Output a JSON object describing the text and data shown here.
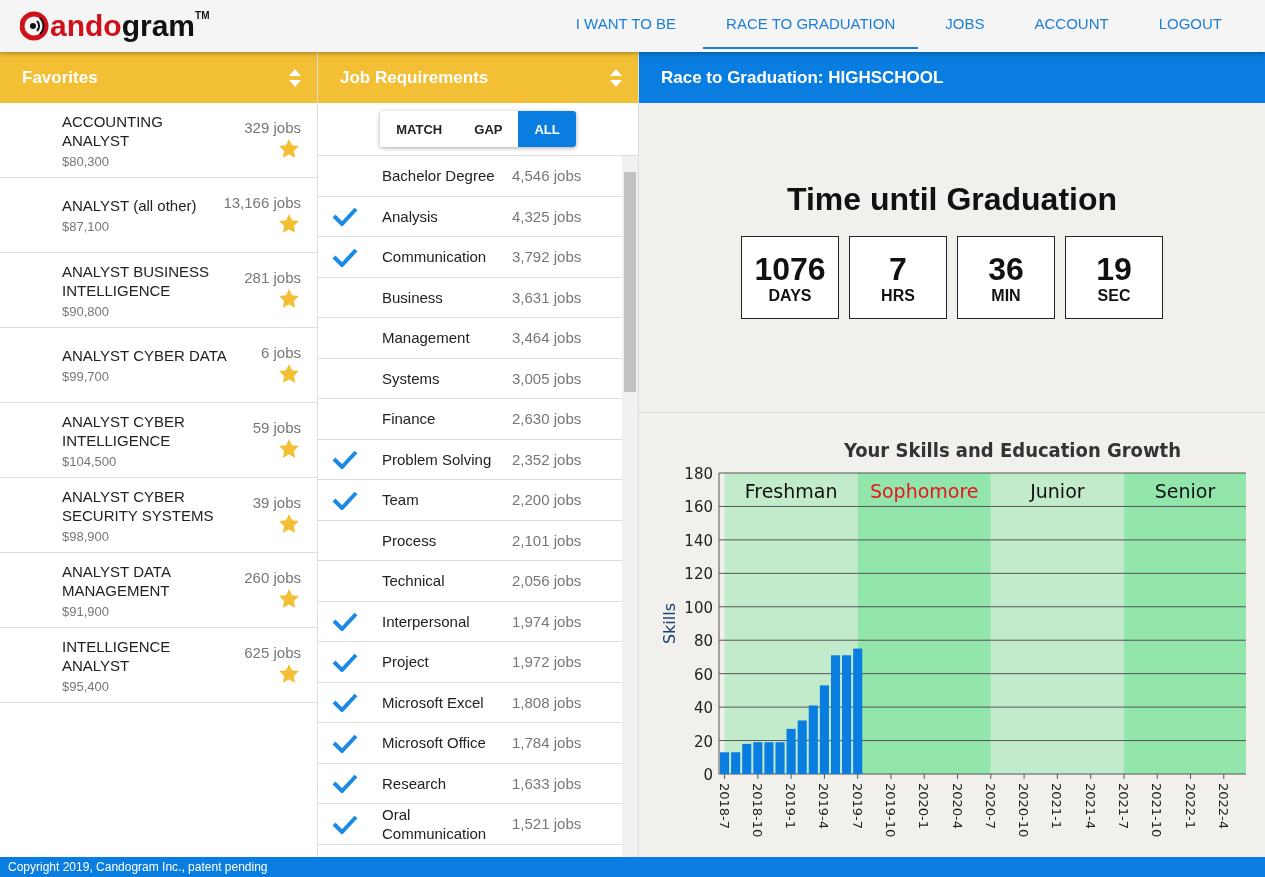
{
  "header": {
    "logo": {
      "red": "ando",
      "black": "gram",
      "tm": "TM"
    },
    "nav": [
      {
        "label": "I WANT TO BE",
        "selected": false
      },
      {
        "label": "RACE TO GRADUATION",
        "selected": true
      },
      {
        "label": "JOBS",
        "selected": false
      },
      {
        "label": "ACCOUNT",
        "selected": false
      },
      {
        "label": "LOGOUT",
        "selected": false
      }
    ]
  },
  "favorites": {
    "title": "Favorites",
    "items": [
      {
        "name": "ACCOUNTING ANALYST",
        "salary": "$80,300",
        "count": "329 jobs",
        "starred": true
      },
      {
        "name": "ANALYST (all other)",
        "salary": "$87,100",
        "count": "13,166 jobs",
        "starred": true
      },
      {
        "name": "ANALYST BUSINESS INTELLIGENCE",
        "salary": "$90,800",
        "count": "281 jobs",
        "starred": true
      },
      {
        "name": "ANALYST CYBER DATA",
        "salary": "$99,700",
        "count": "6 jobs",
        "starred": true
      },
      {
        "name": "ANALYST CYBER INTELLIGENCE",
        "salary": "$104,500",
        "count": "59 jobs",
        "starred": true
      },
      {
        "name": "ANALYST CYBER SECURITY SYSTEMS",
        "salary": "$98,900",
        "count": "39 jobs",
        "starred": true
      },
      {
        "name": "ANALYST DATA MANAGEMENT",
        "salary": "$91,900",
        "count": "260 jobs",
        "starred": true
      },
      {
        "name": "INTELLIGENCE ANALYST",
        "salary": "$95,400",
        "count": "625 jobs",
        "starred": true
      }
    ]
  },
  "requirements": {
    "title": "Job Requirements",
    "filters": [
      {
        "label": "MATCH",
        "selected": false
      },
      {
        "label": "GAP",
        "selected": false
      },
      {
        "label": "ALL",
        "selected": true
      }
    ],
    "items": [
      {
        "name": "Bachelor Degree",
        "count": "4,546 jobs",
        "checked": false
      },
      {
        "name": "Analysis",
        "count": "4,325 jobs",
        "checked": true
      },
      {
        "name": "Communication",
        "count": "3,792 jobs",
        "checked": true
      },
      {
        "name": "Business",
        "count": "3,631 jobs",
        "checked": false
      },
      {
        "name": "Management",
        "count": "3,464 jobs",
        "checked": false
      },
      {
        "name": "Systems",
        "count": "3,005 jobs",
        "checked": false
      },
      {
        "name": "Finance",
        "count": "2,630 jobs",
        "checked": false
      },
      {
        "name": "Problem Solving",
        "count": "2,352 jobs",
        "checked": true
      },
      {
        "name": "Team",
        "count": "2,200 jobs",
        "checked": true
      },
      {
        "name": "Process",
        "count": "2,101 jobs",
        "checked": false
      },
      {
        "name": "Technical",
        "count": "2,056 jobs",
        "checked": false
      },
      {
        "name": "Interpersonal",
        "count": "1,974 jobs",
        "checked": true
      },
      {
        "name": "Project",
        "count": "1,972 jobs",
        "checked": true
      },
      {
        "name": "Microsoft Excel",
        "count": "1,808 jobs",
        "checked": true
      },
      {
        "name": "Microsoft Office",
        "count": "1,784 jobs",
        "checked": true
      },
      {
        "name": "Research",
        "count": "1,633 jobs",
        "checked": true
      },
      {
        "name": "Oral Communication",
        "count": "1,521 jobs",
        "checked": true
      }
    ]
  },
  "race": {
    "title": "Race to Graduation: HIGHSCHOOL",
    "countdown_title": "Time until Graduation",
    "countdown": [
      {
        "value": "1076",
        "unit": "DAYS"
      },
      {
        "value": "7",
        "unit": "HRS"
      },
      {
        "value": "36",
        "unit": "MIN"
      },
      {
        "value": "19",
        "unit": "SEC"
      }
    ],
    "chart_data": {
      "type": "bar",
      "title": "Your Skills and Education Growth",
      "ylabel": "Skills",
      "categories": [
        "2018-7",
        null,
        null,
        "2018-10",
        null,
        null,
        "2019-1",
        null,
        null,
        "2019-4",
        null,
        null,
        "2019-7",
        null,
        null,
        "2019-10",
        null,
        null,
        "2020-1",
        null,
        null,
        "2020-4",
        null,
        null,
        "2020-7",
        null,
        null,
        "2020-10",
        null,
        null,
        "2021-1",
        null,
        null,
        "2021-4",
        null,
        null,
        "2021-7",
        null,
        null,
        "2021-10",
        null,
        null,
        "2022-1",
        null,
        null,
        "2022-4",
        null
      ],
      "series": [
        {
          "color": "#0a7de0",
          "values": [
            13,
            13,
            18,
            19,
            19,
            19,
            27,
            32,
            41,
            53,
            71,
            71,
            75,
            null,
            null,
            null,
            null,
            null,
            null,
            null,
            null,
            null,
            null,
            null,
            null,
            null,
            null,
            null,
            null,
            null,
            null,
            null,
            null,
            null,
            null,
            null,
            null,
            null,
            null,
            null,
            null,
            null,
            null,
            null,
            null,
            null,
            null
          ]
        }
      ],
      "ylim": [
        0,
        180
      ],
      "grid": true,
      "yticks": [
        0,
        20,
        40,
        60,
        80,
        100,
        120,
        140,
        160,
        180
      ]
    },
    "phases": [
      {
        "label": "Freshman",
        "color": "#c2ebcb",
        "current": false
      },
      {
        "label": "Sophomore",
        "color": "#93e6ab",
        "current": true
      },
      {
        "label": "Junior",
        "color": "#c2ebcb",
        "current": false
      },
      {
        "label": "Senior",
        "color": "#93e6ab",
        "current": false
      }
    ]
  },
  "footer": "Copyright 2019, Candogram Inc., patent pending"
}
